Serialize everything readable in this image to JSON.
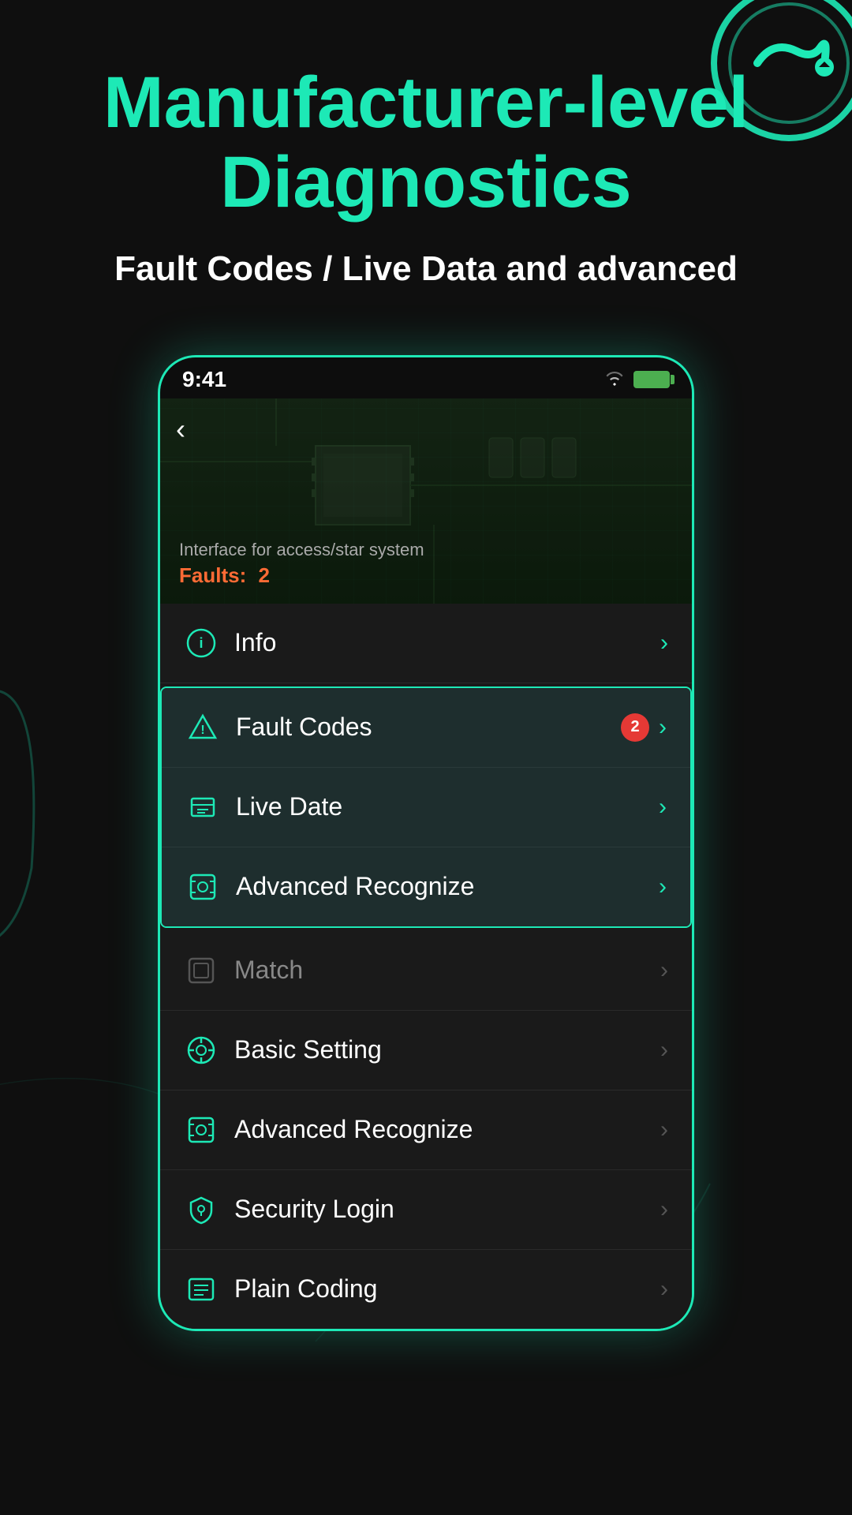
{
  "hero": {
    "title": "Manufacturer-level Diagnostics",
    "subtitle": "Fault Codes / Live Data and advanced"
  },
  "statusBar": {
    "time": "9:41",
    "wifiLabel": "wifi",
    "batteryLabel": "battery"
  },
  "circuit": {
    "description": "Interface for access/star system",
    "faultLabel": "Faults:",
    "faultCount": "2"
  },
  "menuItems": [
    {
      "id": "info",
      "icon": "info",
      "label": "Info",
      "badge": null,
      "highlighted": false,
      "dimArrow": false
    },
    {
      "id": "fault-codes",
      "icon": "warning",
      "label": "Fault Codes",
      "badge": "2",
      "highlighted": true,
      "dimArrow": false
    },
    {
      "id": "live-date",
      "icon": "chart",
      "label": "Live Date",
      "badge": null,
      "highlighted": true,
      "dimArrow": false
    },
    {
      "id": "advanced-recognize-1",
      "icon": "scan",
      "label": "Advanced Recognize",
      "badge": null,
      "highlighted": true,
      "dimArrow": false
    },
    {
      "id": "match",
      "icon": "match",
      "label": "Match",
      "badge": null,
      "highlighted": false,
      "dimArrow": true
    },
    {
      "id": "basic-setting",
      "icon": "gear",
      "label": "Basic Setting",
      "badge": null,
      "highlighted": false,
      "dimArrow": true
    },
    {
      "id": "advanced-recognize-2",
      "icon": "scan",
      "label": "Advanced Recognize",
      "badge": null,
      "highlighted": false,
      "dimArrow": true
    },
    {
      "id": "security-login",
      "icon": "shield",
      "label": "Security Login",
      "badge": null,
      "highlighted": false,
      "dimArrow": true
    },
    {
      "id": "plain-coding",
      "icon": "list",
      "label": "Plain Coding",
      "badge": null,
      "highlighted": false,
      "dimArrow": true
    }
  ]
}
